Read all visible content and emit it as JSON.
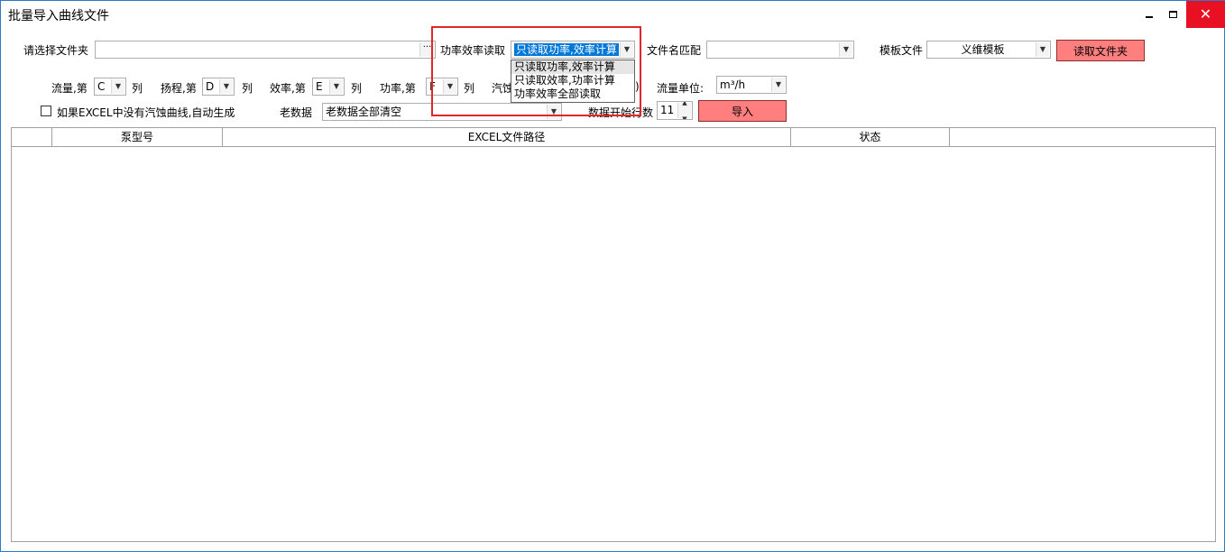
{
  "window": {
    "title": "批量导入曲线文件",
    "close_color": "#e81123"
  },
  "row1": {
    "folder_label": "请选择文件夹",
    "folder_value": "",
    "browse_label": "···",
    "power_eff_label": "功率效率读取",
    "power_eff_value": "只读取功率,效率计算",
    "filename_match_label": "文件名匹配",
    "filename_match_value": "",
    "template_label": "模板文件",
    "template_value": "义维模板",
    "read_folder_button": "读取文件夹"
  },
  "dropdown": {
    "options": [
      "只读取功率,效率计算",
      "只读取效率,功率计算",
      "功率效率全部读取"
    ]
  },
  "row2": {
    "flow_label": "流量,第",
    "flow_col": "C",
    "head_label": "扬程,第",
    "head_col": "D",
    "eff_label": "效率,第",
    "eff_col": "E",
    "power_label": "功率,第",
    "power_col": "F",
    "col_suffix": "列",
    "npsh_label": "汽蚀",
    "npsh_partial": ")",
    "flow_unit_label": "流量单位:",
    "flow_unit_value": "m³/h"
  },
  "row3": {
    "auto_gen_label": "如果EXCEL中没有汽蚀曲线,自动生成",
    "auto_gen_checked": false,
    "old_data_label": "老数据",
    "old_data_value": "老数据全部清空",
    "start_row_label": "数据开始行数",
    "start_row_value": "11",
    "import_button": "导入"
  },
  "grid": {
    "columns": [
      "",
      "泵型号",
      "EXCEL文件路径",
      "状态",
      ""
    ]
  },
  "colors": {
    "accent_red_button": "#ff7f7f",
    "highlight_border": "#e3262a",
    "selection_blue": "#0078d7"
  }
}
